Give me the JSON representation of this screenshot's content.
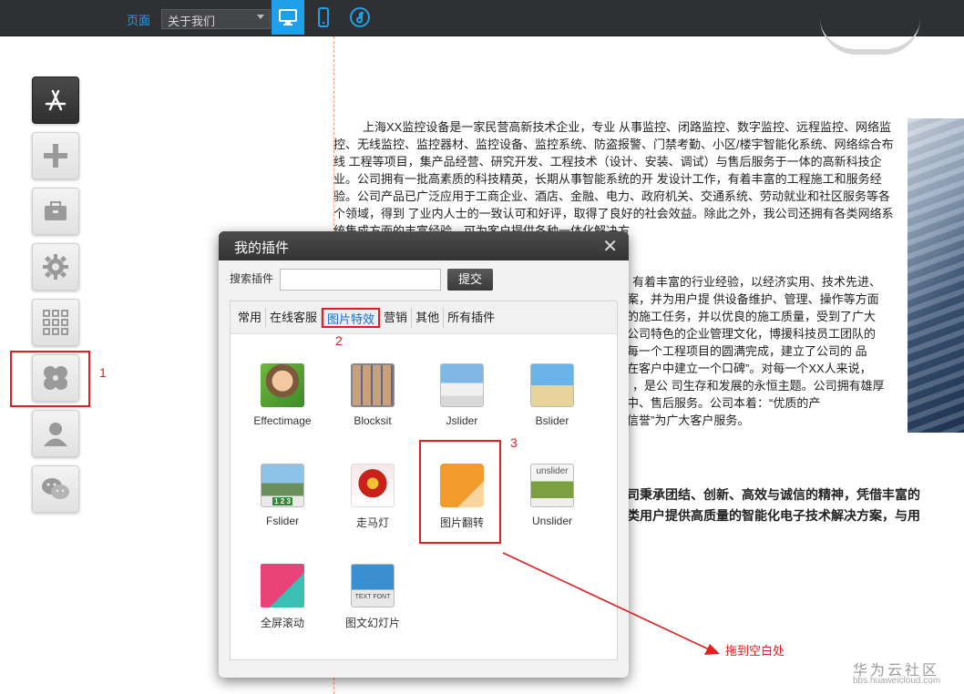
{
  "topbar": {
    "page_label": "页面",
    "page_select_value": "关于我们",
    "device_buttons": [
      {
        "name": "desktop-icon",
        "active": true
      },
      {
        "name": "mobile-icon",
        "active": false
      },
      {
        "name": "music-icon",
        "active": false
      }
    ]
  },
  "sidebar": {
    "items": [
      {
        "name": "app-store-icon"
      },
      {
        "name": "plus-icon"
      },
      {
        "name": "toolbox-icon"
      },
      {
        "name": "gear-icon"
      },
      {
        "name": "grid-icon"
      },
      {
        "name": "plugins-icon"
      },
      {
        "name": "user-icon"
      },
      {
        "name": "wechat-icon"
      }
    ]
  },
  "annotations": {
    "num1": "1",
    "num2": "2",
    "num3": "3",
    "drag_hint": "拖到空白处"
  },
  "content": {
    "paragraph1": "上海XX监控设备是一家民营高新技术企业，专业 从事监控、闭路监控、数字监控、远程监控、网络监控、无线监控、监控器材、监控设备、监控系统、防盗报警、门禁考勤、小区/楼宇智能化系统、网络综合布线 工程等项目，集产品经营、研究开发、工程技术（设计、安装、调试）与售后服务于一体的高新科技企业。公司拥有一批高素质的科技精英，长期从事智能系统的开 发设计工作，有着丰富的工程施工和服务经验。公司产品已广泛应用于工商企业、酒店、金融、电力、政府机关、交通系统、劳动就业和社区服务等各个领域，得到 了业内人士的一致认可和好评，取得了良好的社会效益。除此之外，我公司还拥有各类网络系统集成方面的丰富经验，可为客户提供各种一体化解决方",
    "right_lines": [
      "有着丰富的行业经验，以经济实用、技术先进、",
      "案，并为用户提 供设备维护、管理、操作等方面",
      "的施工任务，并以优良的施工质量，受到了广大",
      "公司特色的企业管理文化，博援科技员工团队的",
      "每一个工程项目的圆满完成，建立了公司的 品",
      "在客户中建立一个口碑”。对每一个XX人来说，",
      "，是公 司生存和发展的永恒主题。公司拥有雄厚",
      "中、售后服务。公司本着：“优质的产",
      "信誉”为广大客户服务。"
    ],
    "bold1": "司秉承团结、创新、高效与诚信的精神，凭借丰富的",
    "bold2": "类用户提供高质量的智能化电子技术解决方案，与用"
  },
  "modal": {
    "title": "我的插件",
    "search_label": "搜索插件",
    "search_value": "",
    "submit_label": "提交",
    "tabs": [
      "常用",
      "在线客服",
      "图片特效",
      "营销",
      "其他",
      "所有插件"
    ],
    "active_tab": "图片特效",
    "plugins": [
      {
        "label": "Effectimage",
        "icon": "effectimage-icon"
      },
      {
        "label": "Blocksit",
        "icon": "blocksit-icon"
      },
      {
        "label": "Jslider",
        "icon": "jslider-icon"
      },
      {
        "label": "Bslider",
        "icon": "bslider-icon"
      },
      {
        "label": "Fslider",
        "icon": "fslider-icon"
      },
      {
        "label": "走马灯",
        "icon": "carousel-icon"
      },
      {
        "label": "图片翻转",
        "icon": "image-flip-icon"
      },
      {
        "label": "Unslider",
        "icon": "unslider-icon"
      },
      {
        "label": "全屏滚动",
        "icon": "fullscreen-scroll-icon"
      },
      {
        "label": "图文幻灯片",
        "icon": "slideshow-icon"
      }
    ],
    "unslider_icon_text": "unslider",
    "slideshow_icon_text": "TEXT FONT",
    "fslider_icon_text": "1 2 3"
  },
  "watermark": {
    "title": "华为云社区",
    "url": "bbs.huaweicloud.com"
  },
  "colors": {
    "accent": "#1fa0e8",
    "annotation": "#e02020",
    "topbar": "#2f3033"
  }
}
